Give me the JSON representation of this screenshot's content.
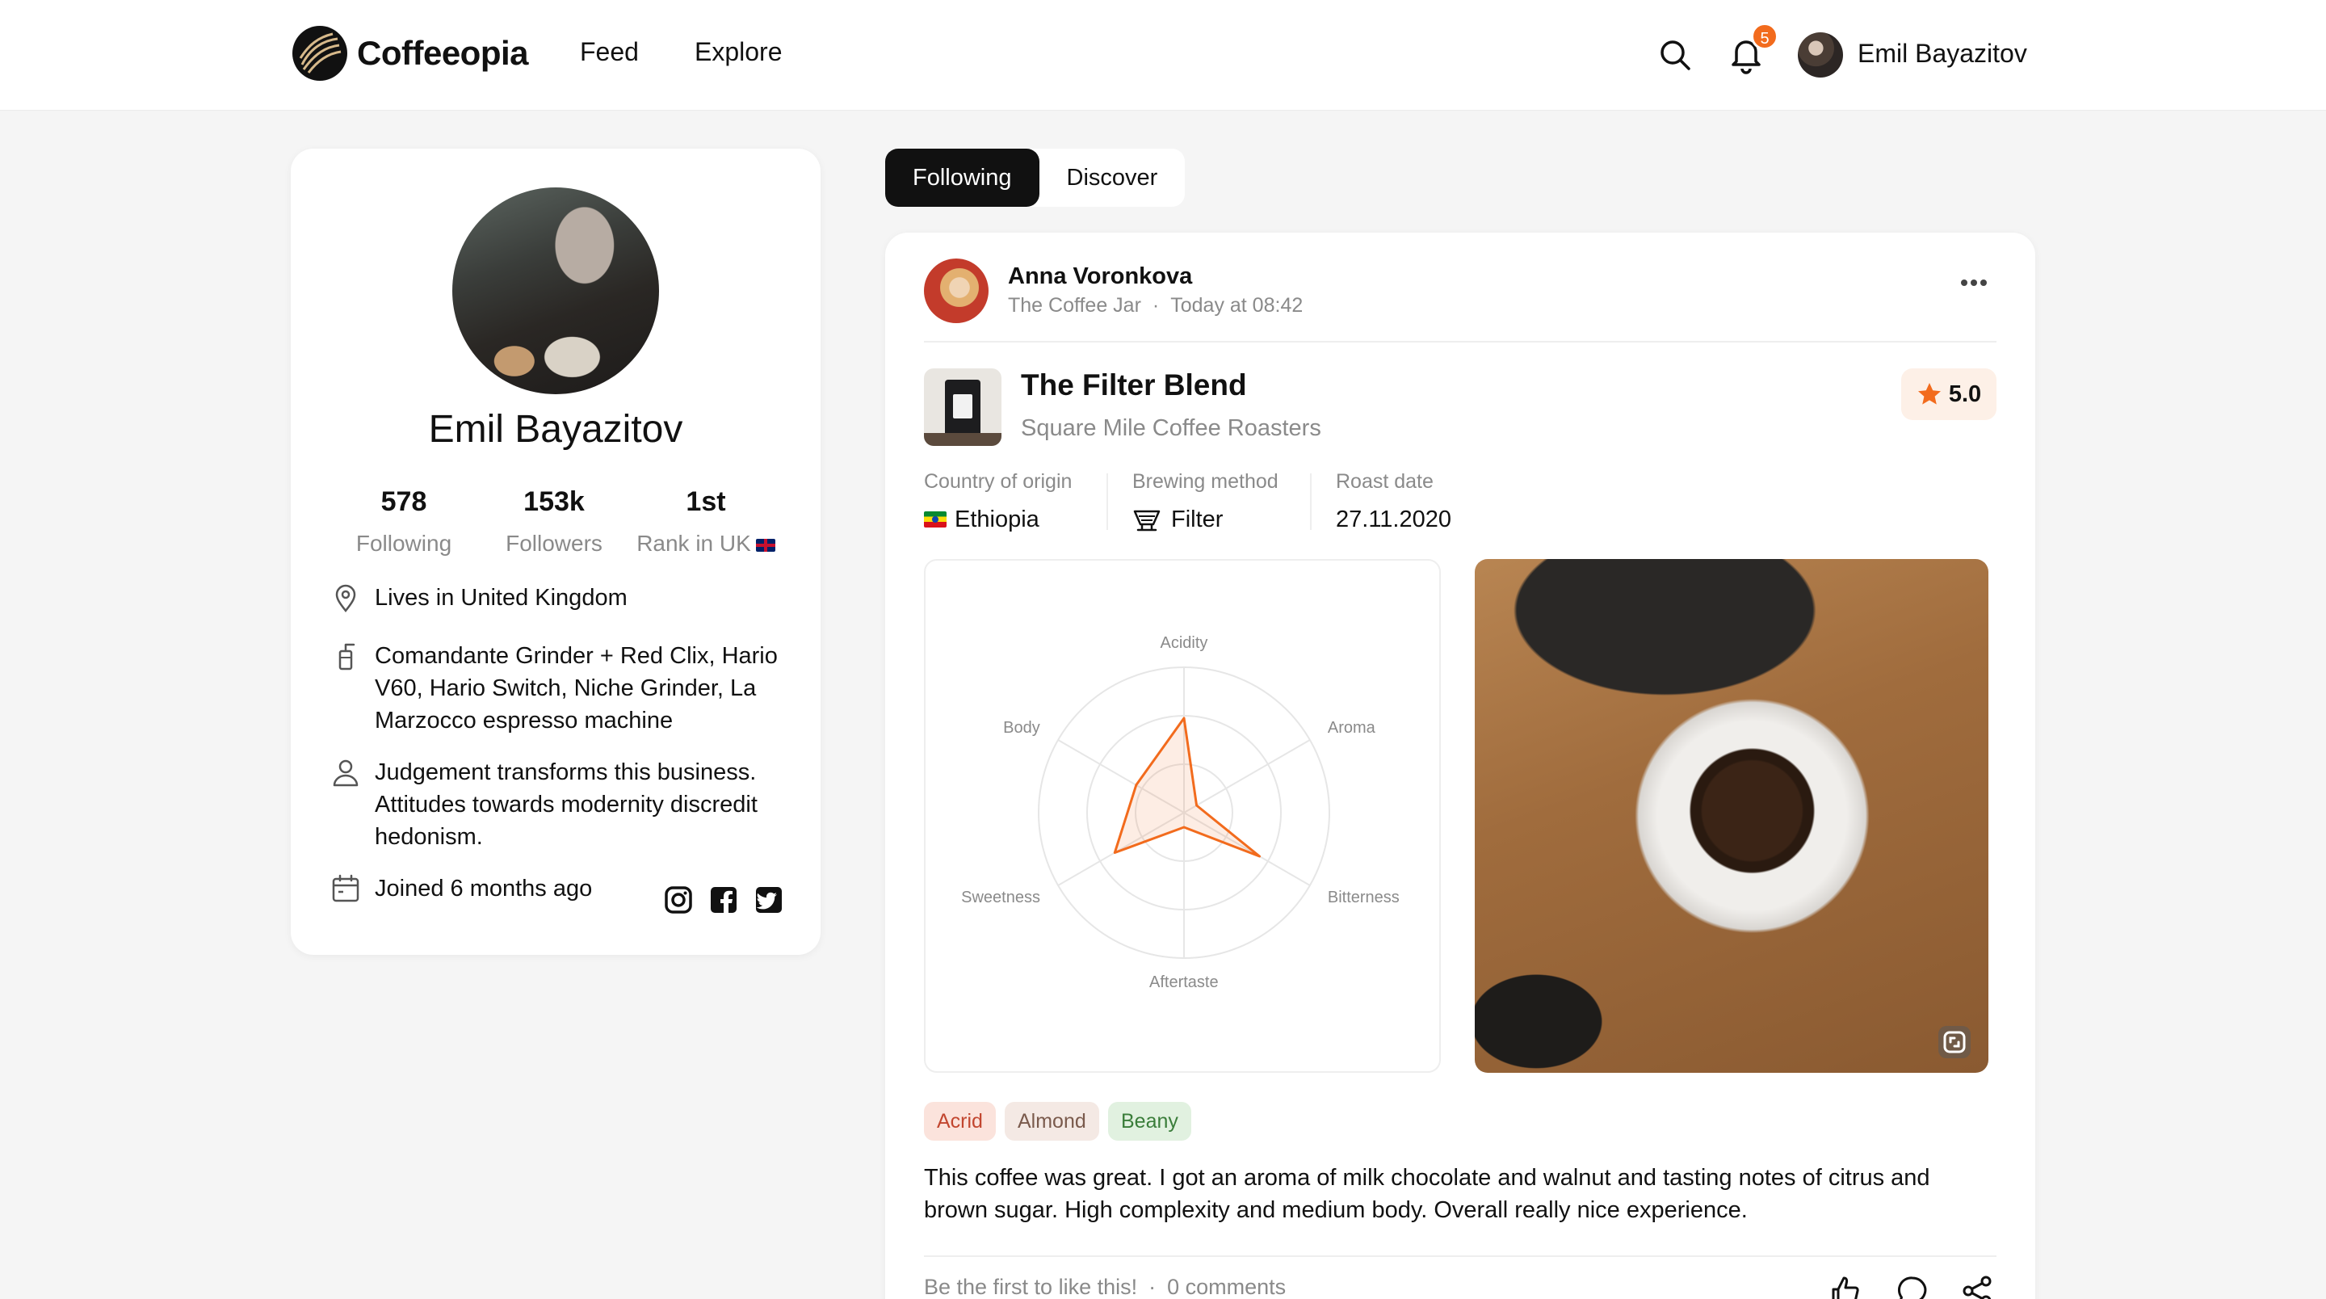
{
  "app": {
    "name": "Coffeeopia",
    "nav": {
      "feed": "Feed",
      "explore": "Explore"
    },
    "notifications_count": "5",
    "current_user": "Emil Bayazitov",
    "accent_color": "#f26b1d"
  },
  "profile": {
    "name": "Emil Bayazitov",
    "stats": [
      {
        "value": "578",
        "label": "Following"
      },
      {
        "value": "153k",
        "label": "Followers"
      },
      {
        "value": "1st",
        "label": "Rank in UK"
      }
    ],
    "location": "Lives in United Kingdom",
    "equipment": "Comandante Grinder + Red Clix, Hario V60, Hario Switch, Niche Grinder, La Marzocco espresso machine",
    "bio": "Judgement transforms this business. Attitudes towards modernity discredit hedonism.",
    "joined": "Joined 6 months ago",
    "social_icons": [
      "instagram-icon",
      "facebook-icon",
      "twitter-icon"
    ]
  },
  "feed_tabs": {
    "following": "Following",
    "discover": "Discover",
    "active": "Following"
  },
  "post": {
    "author": "Anna Voronkova",
    "place": "The Coffee Jar",
    "separator": "·",
    "time": "Today at 08:42",
    "coffee_name": "The Filter Blend",
    "roaster": "Square Mile Coffee Roasters",
    "rating": "5.0",
    "attributes": [
      {
        "label": "Country of origin",
        "value": "Ethiopia",
        "icon": "ethiopia-flag-icon"
      },
      {
        "label": "Brewing method",
        "value": "Filter",
        "icon": "filter-dripper-icon"
      },
      {
        "label": "Roast date",
        "value": "27.11.2020"
      }
    ],
    "tags": [
      "Acrid",
      "Almond",
      "Beany"
    ],
    "review": "This coffee was great. I got an aroma of milk chocolate and walnut and tasting notes of citrus and brown sugar. High complexity and medium body. Overall really nice experience.",
    "likes_text": "Be the first to like this!",
    "comments_text": "0 comments"
  },
  "chart_data": {
    "type": "radar",
    "axes": [
      "Acidity",
      "Aroma",
      "Bitterness",
      "Aftertaste",
      "Sweetness",
      "Body"
    ],
    "values": [
      0.65,
      0.1,
      0.6,
      0.1,
      0.55,
      0.38
    ],
    "range": [
      0,
      1
    ],
    "rings": 3,
    "color": "#f26b1d"
  }
}
